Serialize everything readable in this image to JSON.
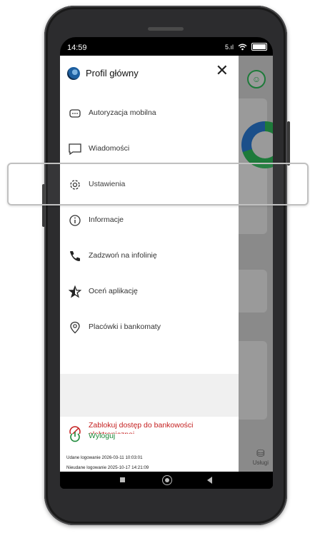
{
  "status_bar": {
    "time": "14:59",
    "signal": "5.ıl",
    "wifi_icon": "wifi-icon",
    "battery_icon": "battery-icon"
  },
  "drawer": {
    "title": "Profil główny",
    "close_icon": "close-icon",
    "items": [
      {
        "label": "Autoryzacja mobilna",
        "icon": "mobile-authorization-icon"
      },
      {
        "label": "Wiadomości",
        "icon": "message-icon"
      },
      {
        "label": "Ustawienia",
        "icon": "gear-icon"
      },
      {
        "label": "Informacje",
        "icon": "info-icon"
      },
      {
        "label": "Zadzwoń na infolinię",
        "icon": "phone-icon"
      },
      {
        "label": "Oceń aplikację",
        "icon": "star-icon"
      },
      {
        "label": "Placówki i bankomaty",
        "icon": "location-icon"
      }
    ],
    "block_access": {
      "label": "Zablokuj dostęp do bankowości elektronicznej",
      "icon": "block-icon",
      "color": "#c41e1e"
    },
    "logout": {
      "label": "Wyloguj",
      "icon": "power-icon",
      "color": "#1e8a3a"
    },
    "login_success": "Udane logowanie 2026-03-11 10:03:01",
    "login_failed": "Nieudane logowanie 2025-10-17 14:21:09"
  },
  "background_app": {
    "services_label": "Usługi",
    "services_icon": "database-icon"
  },
  "nav_bar": {
    "recent_icon": "square-icon",
    "home_icon": "circle-icon",
    "back_icon": "triangle-back-icon"
  },
  "accent_colors": {
    "green": "#1e7a3a",
    "red": "#c41e1e"
  }
}
